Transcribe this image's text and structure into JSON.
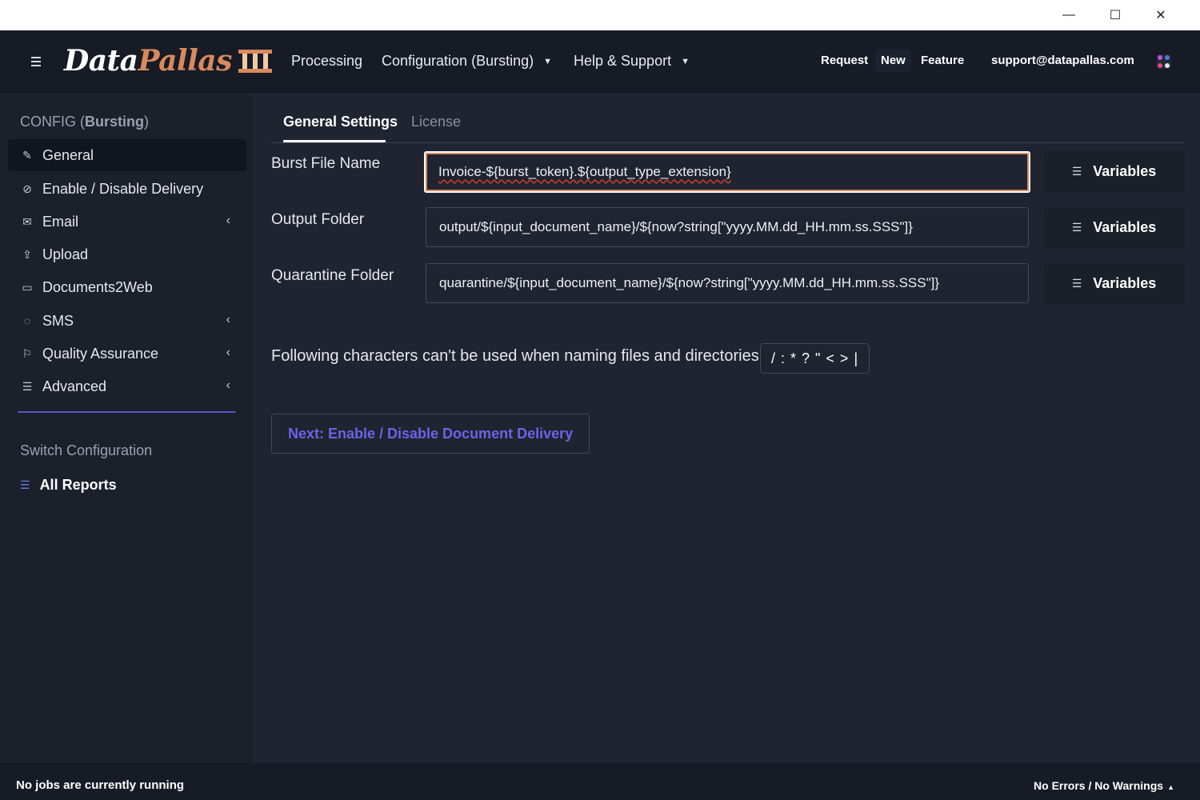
{
  "window": {
    "minimize_glyph": "—",
    "maximize_glyph": "☐",
    "close_glyph": "✕"
  },
  "navbar": {
    "logo_data": "Data",
    "logo_pallas": "Pallas",
    "logo_mark_icon": "roman-numeral-three-icon",
    "menu": {
      "processing": "Processing",
      "configuration": "Configuration (Bursting)",
      "help": "Help & Support"
    },
    "right": {
      "request": "Request",
      "new": "New",
      "feature": "Feature",
      "support_email": "support@datapallas.com"
    },
    "colors": {
      "brand_accent": "#d9895c",
      "background": "#161b26"
    }
  },
  "sidebar": {
    "header_prefix": "CONFIG (",
    "header_bold": "Bursting",
    "header_suffix": ")",
    "items": [
      {
        "label": "General",
        "icon": "pencil-icon",
        "active": true
      },
      {
        "label": "Enable / Disable Delivery",
        "icon": "check-circle-icon"
      },
      {
        "label": "Email",
        "icon": "envelope-icon",
        "expandable": true
      },
      {
        "label": "Upload",
        "icon": "upload-icon"
      },
      {
        "label": "Documents2Web",
        "icon": "browser-window-icon"
      },
      {
        "label": "SMS",
        "icon": "chat-bubble-icon",
        "expandable": true
      },
      {
        "label": "Quality Assurance",
        "icon": "flag-icon",
        "expandable": true
      },
      {
        "label": "Advanced",
        "icon": "sliders-icon",
        "expandable": true
      }
    ],
    "switch_header": "Switch Configuration",
    "all_reports": "All Reports"
  },
  "main": {
    "tabs": [
      {
        "label": "General Settings",
        "active": true
      },
      {
        "label": "License",
        "active": false
      }
    ],
    "fields": [
      {
        "label": "Burst File Name",
        "value": "Invoice-${burst_token}.${output_type_extension}",
        "button": "Variables",
        "focused": true
      },
      {
        "label": "Output Folder",
        "value": "output/${input_document_name}/${now?string[\"yyyy.MM.dd_HH.mm.ss.SSS\"]}",
        "button": "Variables"
      },
      {
        "label": "Quarantine Folder",
        "value": "quarantine/${input_document_name}/${now?string[\"yyyy.MM.dd_HH.mm.ss.SSS\"]}",
        "button": "Variables"
      }
    ],
    "invalid_chars_text": "Following characters can't be used when naming files and directories",
    "invalid_chars": "/ : * ? \" < > |",
    "next_button": "Next: Enable / Disable Document Delivery",
    "colors": {
      "next_button_text": "#6b63e8",
      "focus_ring": "#d9895c"
    }
  },
  "statusbar": {
    "left": "No jobs are currently running",
    "right": "No Errors / No Warnings"
  }
}
